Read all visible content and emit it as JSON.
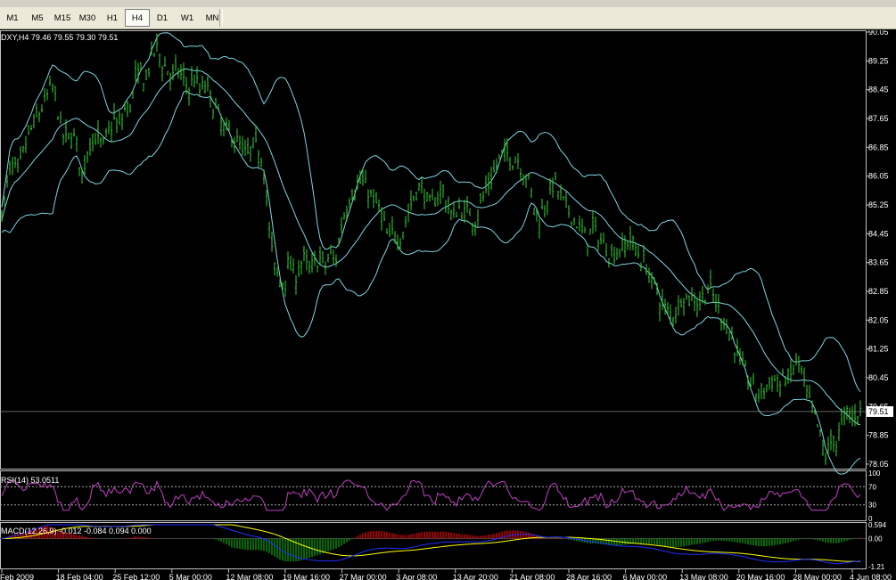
{
  "toolbar": {
    "timeframes": [
      "M1",
      "M5",
      "M15",
      "M30",
      "H1",
      "H4",
      "D1",
      "W1",
      "MN"
    ],
    "active": "H4"
  },
  "chart_data": {
    "type": "candlestick",
    "symbol_header": "DXY,H4  79.46 79.55 79.30 79.51",
    "current_price": "79.51",
    "price_axis": [
      "90.05",
      "89.25",
      "88.45",
      "87.65",
      "86.85",
      "86.05",
      "85.25",
      "84.45",
      "83.65",
      "82.85",
      "82.05",
      "81.25",
      "80.45",
      "79.65",
      "78.85",
      "78.05"
    ],
    "ylim": [
      77.95,
      90.05
    ],
    "x_labels": [
      "Feb 2009",
      "18 Feb 04:00",
      "25 Feb 12:00",
      "5 Mar 00:00",
      "12 Mar 08:00",
      "19 Mar 16:00",
      "27 Mar 00:00",
      "3 Apr 08:00",
      "13 Apr 20:00",
      "21 Apr 08:00",
      "28 Apr 16:00",
      "6 May 00:00",
      "13 May 08:00",
      "20 May 16:00",
      "28 May 00:00",
      "4 Jun 08:00"
    ],
    "close_path": [
      [
        0,
        84.9
      ],
      [
        5,
        85.3
      ],
      [
        12,
        86.4
      ],
      [
        20,
        86.1
      ],
      [
        28,
        86.9
      ],
      [
        36,
        87.4
      ],
      [
        44,
        87.8
      ],
      [
        52,
        88.2
      ],
      [
        58,
        88.6
      ],
      [
        64,
        88.0
      ],
      [
        70,
        87.2
      ],
      [
        75,
        87.0
      ],
      [
        80,
        87.3
      ],
      [
        86,
        86.9
      ],
      [
        92,
        86.0
      ],
      [
        98,
        86.8
      ],
      [
        104,
        87.2
      ],
      [
        110,
        87.0
      ],
      [
        116,
        86.9
      ],
      [
        122,
        87.3
      ],
      [
        128,
        87.6
      ],
      [
        134,
        87.4
      ],
      [
        140,
        87.9
      ],
      [
        146,
        88.0
      ],
      [
        152,
        88.7
      ],
      [
        158,
        88.9
      ],
      [
        164,
        88.7
      ],
      [
        170,
        89.4
      ],
      [
        176,
        89.6
      ],
      [
        182,
        89.2
      ],
      [
        188,
        89.0
      ],
      [
        194,
        88.8
      ],
      [
        200,
        89.0
      ],
      [
        206,
        88.7
      ],
      [
        212,
        88.5
      ],
      [
        218,
        88.8
      ],
      [
        224,
        88.4
      ],
      [
        230,
        88.6
      ],
      [
        236,
        88.2
      ],
      [
        242,
        87.9
      ],
      [
        248,
        87.5
      ],
      [
        254,
        87.3
      ],
      [
        260,
        87.2
      ],
      [
        266,
        87.0
      ],
      [
        272,
        86.8
      ],
      [
        278,
        86.6
      ],
      [
        284,
        86.9
      ],
      [
        290,
        86.8
      ],
      [
        296,
        86.4
      ],
      [
        300,
        85.0
      ],
      [
        303,
        84.3
      ],
      [
        308,
        83.5
      ],
      [
        313,
        83.2
      ],
      [
        318,
        83.1
      ],
      [
        323,
        83.6
      ],
      [
        328,
        83.4
      ],
      [
        333,
        83.3
      ],
      [
        340,
        83.8
      ],
      [
        346,
        83.4
      ],
      [
        352,
        83.6
      ],
      [
        358,
        83.8
      ],
      [
        364,
        83.5
      ],
      [
        370,
        83.9
      ],
      [
        376,
        83.6
      ],
      [
        382,
        84.6
      ],
      [
        388,
        85.2
      ],
      [
        394,
        85.6
      ],
      [
        400,
        85.8
      ],
      [
        406,
        85.9
      ],
      [
        412,
        85.7
      ],
      [
        418,
        85.4
      ],
      [
        424,
        85.2
      ],
      [
        430,
        84.8
      ],
      [
        436,
        84.2
      ],
      [
        442,
        84.6
      ],
      [
        448,
        84.3
      ],
      [
        454,
        84.7
      ],
      [
        460,
        85.2
      ],
      [
        466,
        85.6
      ],
      [
        472,
        85.8
      ],
      [
        478,
        85.4
      ],
      [
        484,
        85.2
      ],
      [
        490,
        85.5
      ],
      [
        496,
        85.7
      ],
      [
        502,
        85.2
      ],
      [
        508,
        84.9
      ],
      [
        514,
        85.2
      ],
      [
        520,
        85.0
      ],
      [
        526,
        85.1
      ],
      [
        532,
        84.8
      ],
      [
        538,
        85.2
      ],
      [
        544,
        85.6
      ],
      [
        550,
        85.9
      ],
      [
        556,
        86.3
      ],
      [
        562,
        86.6
      ],
      [
        568,
        86.7
      ],
      [
        574,
        86.5
      ],
      [
        580,
        86.6
      ],
      [
        586,
        86.2
      ],
      [
        592,
        86.0
      ],
      [
        598,
        85.3
      ],
      [
        604,
        84.8
      ],
      [
        610,
        85.2
      ],
      [
        616,
        85.6
      ],
      [
        622,
        85.9
      ],
      [
        628,
        85.5
      ],
      [
        634,
        85.2
      ],
      [
        640,
        85.0
      ],
      [
        646,
        84.8
      ],
      [
        652,
        84.5
      ],
      [
        658,
        84.3
      ],
      [
        664,
        84.6
      ],
      [
        670,
        84.4
      ],
      [
        676,
        84.2
      ],
      [
        682,
        84.0
      ],
      [
        688,
        83.9
      ],
      [
        694,
        84.0
      ],
      [
        700,
        84.1
      ],
      [
        706,
        84.3
      ],
      [
        712,
        84.1
      ],
      [
        718,
        83.8
      ],
      [
        724,
        83.6
      ],
      [
        730,
        83.2
      ],
      [
        736,
        82.9
      ],
      [
        742,
        82.5
      ],
      [
        748,
        82.3
      ],
      [
        754,
        82.2
      ],
      [
        760,
        82.4
      ],
      [
        766,
        82.8
      ],
      [
        772,
        82.6
      ],
      [
        778,
        82.7
      ],
      [
        784,
        82.5
      ],
      [
        790,
        82.8
      ],
      [
        796,
        82.9
      ],
      [
        802,
        82.6
      ],
      [
        808,
        82.2
      ],
      [
        814,
        82.0
      ],
      [
        820,
        81.6
      ],
      [
        826,
        81.2
      ],
      [
        832,
        80.8
      ],
      [
        838,
        80.5
      ],
      [
        844,
        80.2
      ],
      [
        850,
        80.0
      ],
      [
        856,
        80.1
      ],
      [
        862,
        80.3
      ],
      [
        868,
        80.4
      ],
      [
        874,
        80.2
      ],
      [
        880,
        80.5
      ],
      [
        886,
        80.4
      ],
      [
        892,
        80.9
      ],
      [
        898,
        80.7
      ],
      [
        902,
        80.2
      ],
      [
        906,
        79.9
      ],
      [
        910,
        79.6
      ],
      [
        914,
        79.3
      ],
      [
        918,
        79.0
      ],
      [
        922,
        78.6
      ],
      [
        926,
        78.3
      ],
      [
        930,
        78.5
      ],
      [
        934,
        78.8
      ],
      [
        938,
        78.6
      ],
      [
        942,
        79.0
      ],
      [
        946,
        79.3
      ],
      [
        950,
        79.5
      ],
      [
        956,
        79.4
      ],
      [
        962,
        79.5
      ],
      [
        966,
        79.51
      ]
    ],
    "indicators": {
      "bands": "Bollinger Bands",
      "rsi_label": "RSI(14) 53.0511",
      "rsi_scale": [
        "100",
        "70",
        "30",
        "0"
      ],
      "macd_label": "MACD(12,26,9) -0.012 -0.084 0.094 0.000",
      "macd_scale": [
        "0.594",
        "0.00",
        "-1.21"
      ]
    }
  },
  "colors": {
    "candles": "#33cc33",
    "bands": "#7fd4e0",
    "rsi": "#c040c0",
    "macd_signal": "#ffff00",
    "macd_main": "#2030ff",
    "hist_pos": "#cc0000",
    "hist_neg": "#0a8a0a",
    "axis_text": "#ffffff"
  }
}
